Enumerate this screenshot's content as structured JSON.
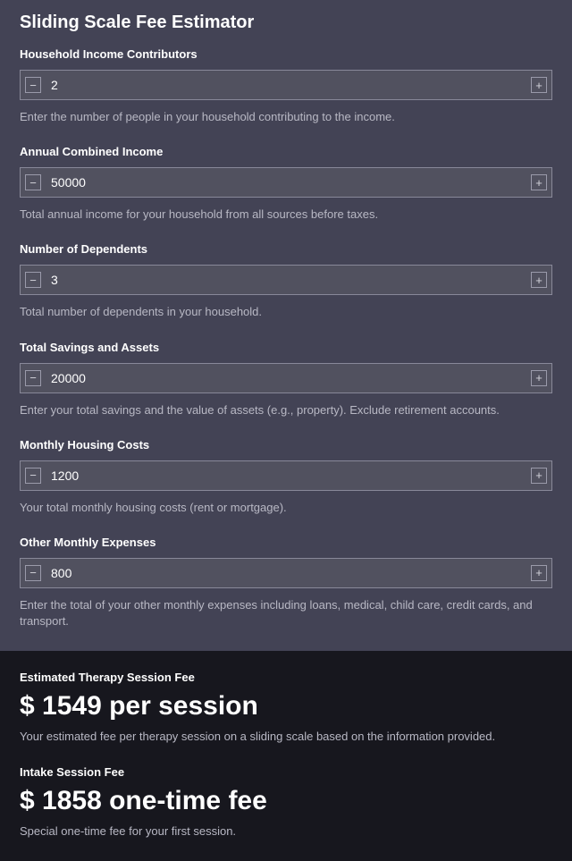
{
  "title": "Sliding Scale Fee Estimator",
  "fields": [
    {
      "label": "Household Income Contributors",
      "value": "2",
      "help": "Enter the number of people in your household contributing to the income."
    },
    {
      "label": "Annual Combined Income",
      "value": "50000",
      "help": "Total annual income for your household from all sources before taxes."
    },
    {
      "label": "Number of Dependents",
      "value": "3",
      "help": "Total number of dependents in your household."
    },
    {
      "label": "Total Savings and Assets",
      "value": "20000",
      "help": "Enter your total savings and the value of assets (e.g., property). Exclude retirement accounts."
    },
    {
      "label": "Monthly Housing Costs",
      "value": "1200",
      "help": "Your total monthly housing costs (rent or mortgage)."
    },
    {
      "label": "Other Monthly Expenses",
      "value": "800",
      "help": "Enter the total of your other monthly expenses including loans, medical, child care, credit cards, and transport."
    }
  ],
  "results": [
    {
      "label": "Estimated Therapy Session Fee",
      "value": "$ 1549 per session",
      "help": "Your estimated fee per therapy session on a sliding scale based on the information provided."
    },
    {
      "label": "Intake Session Fee",
      "value": "$ 1858 one-time fee",
      "help": "Special one-time fee for your first session."
    }
  ]
}
